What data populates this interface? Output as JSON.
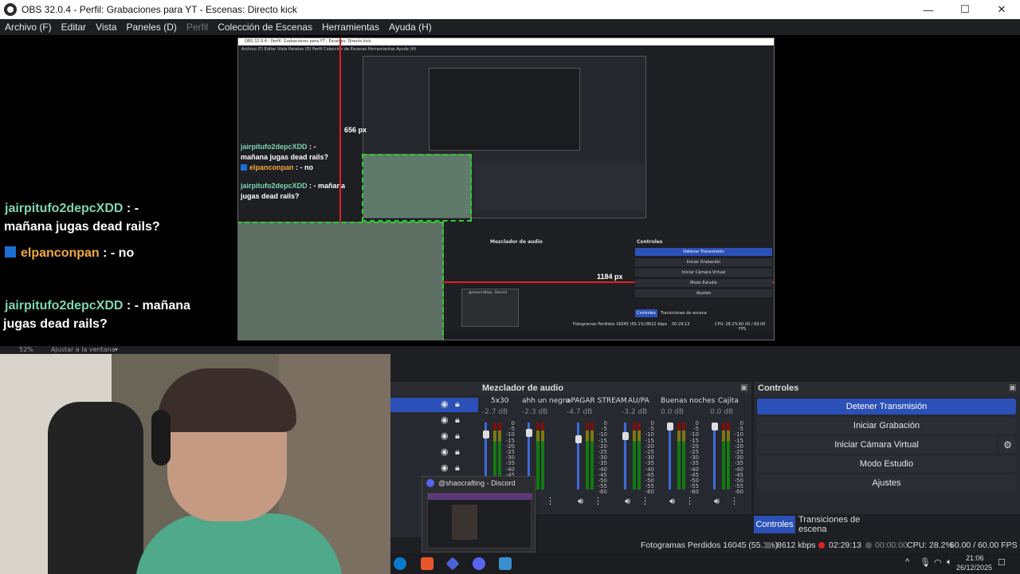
{
  "window": {
    "title": "OBS 32.0.4 - Perfil: Grabaciones para YT - Escenas: Directo kick",
    "minimize": "—",
    "maximize": "☐",
    "close": "✕"
  },
  "menu": [
    {
      "label": "Archivo (F)",
      "enabled": true
    },
    {
      "label": "Editar",
      "enabled": true
    },
    {
      "label": "Vista",
      "enabled": true
    },
    {
      "label": "Paneles (D)",
      "enabled": true
    },
    {
      "label": "Perfil",
      "enabled": false
    },
    {
      "label": "Colección de Escenas",
      "enabled": true
    },
    {
      "label": "Herramientas",
      "enabled": true
    },
    {
      "label": "Ayuda (H)",
      "enabled": true
    }
  ],
  "chat": {
    "msg1_user": "jairpitufo2depcXDD",
    "msg1_sep": " : -",
    "msg1_text": "mañana jugas dead rails?",
    "msg2_user": "elpanconpan",
    "msg2_text": " : - no",
    "msg3_user": "jairpitufo2depcXDD",
    "msg3_sep": " : - mañana",
    "msg3_text": "jugas dead rails?"
  },
  "nested_preview": {
    "title": "OBS 32.0.4 - Perfil: Grabaciones para YT - Escenas: Directo kick",
    "menu": "Archivo (F)   Editar   Vista   Paneles (D)   Perfil   Colección de Escenas   Herramientas   Ayuda (H)",
    "chat_user": "jairpitufo2depcXDD",
    "chat_sep": " : -",
    "chat_text": "mañana jugas dead rails?",
    "chat_user2": "elpanconpan",
    "chat_text2": " : - no",
    "chat_user3": "jairpitufo2depcXDD",
    "chat_sep3": " : - mañana",
    "chat_text3": "jugas dead rails?",
    "px_top": "656 px",
    "px_right": "1184 px",
    "mixer_header": "Mezclador de audio",
    "controls_header": "Controles",
    "buttons": [
      "Detener Transmisión",
      "Iniciar Grabación",
      "Iniciar Cámara Virtual",
      "Modo Estudio",
      "Ajustes"
    ],
    "tab_controls": "Controles",
    "tab_transitions": "Transiciones de escena",
    "status_dropped": "Fotogramas Perdidos 16045 (55.1%)",
    "status_kbps": "8612 kbps",
    "status_time": "00:29:13",
    "status_cpu": "CPU: 28.2%",
    "status_fps": "60.00 / 60.00 FPS",
    "discord": "@shaocrafting - Discord"
  },
  "zoom": {
    "value": "52%",
    "fit": "Ajustar a la ventana"
  },
  "mixer": {
    "header": "Mezclador de audio",
    "channels": [
      {
        "name": "5x30",
        "db": "-2.7 dB"
      },
      {
        "name": "ahh un negro",
        "db": "-2.3 dB"
      },
      {
        "name": "aPAGAR STREAM",
        "db": "-4.7 dB"
      },
      {
        "name": "AU/PA",
        "db": "-3.2 dB"
      },
      {
        "name": "Buenas noches",
        "db": "0.0 dB"
      },
      {
        "name": "Cajita",
        "db": "0.0 dB"
      }
    ],
    "scale": [
      "0",
      "-5",
      "-10",
      "-15",
      "-20",
      "-25",
      "-30",
      "-35",
      "-40",
      "-45",
      "-50",
      "-55",
      "-60"
    ]
  },
  "controls": {
    "header": "Controles",
    "stop_stream": "Detener Transmisión",
    "start_recording": "Iniciar Grabación",
    "start_virtual_cam": "Iniciar Cámara Virtual",
    "studio_mode": "Modo Estudio",
    "settings": "Ajustes"
  },
  "tabs": {
    "controls": "Controles",
    "transitions": "Transiciones de escena"
  },
  "status": {
    "dropped_frames": "Fotogramas Perdidos 16045 (55.1%)",
    "bitrate": "8612 kbps",
    "stream_time": "02:29:13",
    "record_time": "00:00:00",
    "cpu": "CPU: 28.2%",
    "fps": "60.00 / 60.00 FPS"
  },
  "discord_popup": {
    "title": "@shaocrafting - Discord"
  },
  "clock": {
    "time": "21:06",
    "date": "26/12/2025"
  },
  "colors": {
    "accent": "#2b50b8",
    "chat_user": "#7bd7b0",
    "chat_user2": "#f2a93b",
    "live_indicator": "#d22222"
  }
}
